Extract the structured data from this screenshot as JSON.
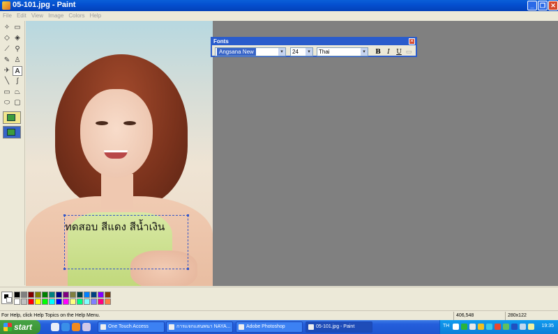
{
  "window": {
    "title": "05-101.jpg - Paint",
    "minimize": "_",
    "maximize": "❐",
    "close": "✕"
  },
  "menu": [
    "File",
    "Edit",
    "View",
    "Image",
    "Colors",
    "Help"
  ],
  "tools": [
    {
      "name": "free-select-tool",
      "glyph": "✧"
    },
    {
      "name": "rect-select-tool",
      "glyph": "▭"
    },
    {
      "name": "eraser-tool",
      "glyph": "◇"
    },
    {
      "name": "fill-tool",
      "glyph": "◈"
    },
    {
      "name": "color-picker-tool",
      "glyph": "⟋"
    },
    {
      "name": "magnifier-tool",
      "glyph": "⚲"
    },
    {
      "name": "pencil-tool",
      "glyph": "✎"
    },
    {
      "name": "brush-tool",
      "glyph": "♙"
    },
    {
      "name": "airbrush-tool",
      "glyph": "✈"
    },
    {
      "name": "text-tool",
      "glyph": "A"
    },
    {
      "name": "line-tool",
      "glyph": "╲"
    },
    {
      "name": "curve-tool",
      "glyph": "∫"
    },
    {
      "name": "rectangle-tool",
      "glyph": "▭"
    },
    {
      "name": "polygon-tool",
      "glyph": "⏢"
    },
    {
      "name": "ellipse-tool",
      "glyph": "⬭"
    },
    {
      "name": "rounded-rect-tool",
      "glyph": "▢"
    }
  ],
  "canvas": {
    "text": "ทดสอบ สีแดง สีน้ำเงิน"
  },
  "fonts_toolbar": {
    "title": "Fonts",
    "close": "✕",
    "font_name": "Angsana New",
    "font_size": "24",
    "script": "Thai",
    "bold": "B",
    "italic": "I",
    "underline": "U",
    "arrow": "▾"
  },
  "palette": {
    "colors_top": [
      "#000000",
      "#808080",
      "#800000",
      "#808000",
      "#008000",
      "#008080",
      "#000080",
      "#800080",
      "#808040",
      "#004040",
      "#0080ff",
      "#004080",
      "#8000ff",
      "#804000"
    ],
    "colors_bottom": [
      "#ffffff",
      "#c0c0c0",
      "#ff0000",
      "#ffff00",
      "#00ff00",
      "#00ffff",
      "#0000ff",
      "#ff00ff",
      "#ffff80",
      "#00ff80",
      "#80ffff",
      "#8080ff",
      "#ff0080",
      "#ff8040"
    ]
  },
  "status": {
    "help": "For Help, click Help Topics on the Help Menu.",
    "coords": "406,548",
    "size": "280x122"
  },
  "taskbar": {
    "start": "start",
    "tasks": [
      {
        "label": "One Touch Access",
        "active": false
      },
      {
        "label": "การแจกแสนพนา NAYA...",
        "active": false
      },
      {
        "label": "Adobe Photoshop",
        "active": false
      },
      {
        "label": "05-101.jpg - Paint",
        "active": true
      }
    ],
    "lang": "TH",
    "clock": "19:35"
  }
}
